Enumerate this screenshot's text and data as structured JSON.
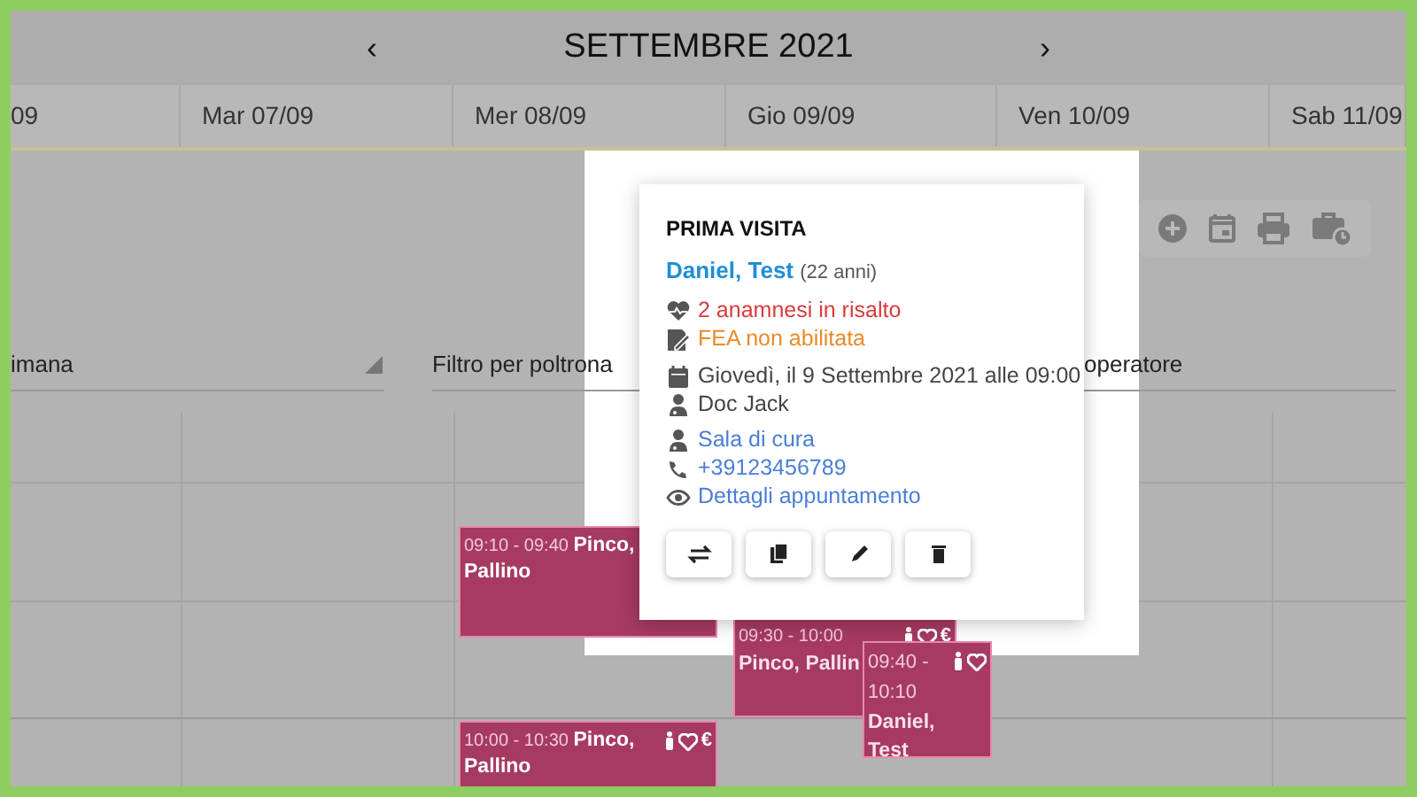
{
  "calendar": {
    "prev": "‹",
    "title": "SETTEMBRE 2021",
    "next": "›",
    "days": [
      "09",
      "Mar 07/09",
      "Mer 08/09",
      "Gio 09/09",
      "Ven 10/09",
      "Sab 11/09"
    ]
  },
  "filters": [
    {
      "kind": "select",
      "label": "imana"
    },
    {
      "kind": "text",
      "label": "Filtro per poltrona"
    },
    {
      "kind": "text",
      "label": "operatore"
    }
  ],
  "events": [
    {
      "time": "09:10 - 09:40",
      "patient": "Pinco,",
      "patient_rest": "Pallino"
    },
    {
      "time": "09:30 - 10:00",
      "patient": "Pinco, Pallin",
      "currency": "€"
    },
    {
      "time": "10:00 - 10:30",
      "patient": "Pinco,",
      "patient_rest": "Pallino",
      "currency": "€"
    },
    {
      "time": "09:40 - 10:10",
      "patient": "Daniel, Test"
    }
  ],
  "popup": {
    "title": "PRIMA VISITA",
    "patient": "Daniel, Test",
    "age": "(22 anni)",
    "lines": [
      {
        "kind": "anamnesi",
        "text": "2 anamnesi in risalto"
      },
      {
        "kind": "fea",
        "text": "FEA non abilitata"
      },
      {
        "kind": "date",
        "text": "Giovedì, il 9 Settembre 2021 alle 09:00"
      },
      {
        "kind": "doctor",
        "text": "Doc Jack"
      },
      {
        "kind": "room",
        "text": "Sala di cura"
      },
      {
        "kind": "phone",
        "text": "+39123456789"
      },
      {
        "kind": "details",
        "text": "Dettagli appuntamento"
      }
    ]
  }
}
